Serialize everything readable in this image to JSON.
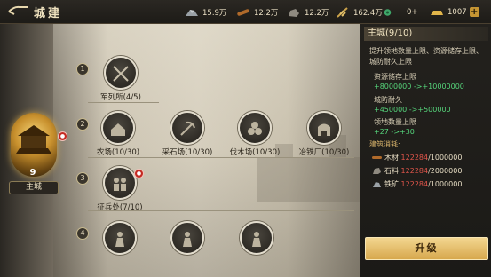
{
  "header": {
    "title": "城建"
  },
  "resources": [
    {
      "icon": "silver-ore-icon",
      "value": "15.9万"
    },
    {
      "icon": "wood-icon",
      "value": "12.2万"
    },
    {
      "icon": "stone-icon",
      "value": "12.2万"
    },
    {
      "icon": "grain-icon",
      "value": "162.4万"
    },
    {
      "icon": "jade-icon",
      "value": "0+"
    },
    {
      "icon": "gold-icon",
      "value": "1007"
    }
  ],
  "map": {
    "tiers": [
      "1",
      "2",
      "3",
      "4"
    ],
    "main_city": {
      "level": "9",
      "name": "主城"
    },
    "buildings": {
      "barracks": "军列所(4/5)",
      "farm": "农场(10/30)",
      "quarry": "采石场(10/30)",
      "lumber": "伐木场(10/30)",
      "smelter": "冶铁厂(10/30)",
      "recruit": "征兵处(7/10)"
    }
  },
  "panel": {
    "title": "主城(9/10)",
    "description": "提升领地数量上限、资源储存上限、城防耐久上限",
    "stats": [
      {
        "name": "资源储存上限",
        "value": "+8000000 ->+10000000"
      },
      {
        "name": "城防耐久",
        "value": "+450000 ->+500000"
      },
      {
        "name": "领地数量上限",
        "value": "+27 ->+30"
      }
    ],
    "cost_title": "建筑消耗:",
    "costs": [
      {
        "name": "木材",
        "have": "122284",
        "need": "/1000000"
      },
      {
        "name": "石料",
        "have": "122284",
        "need": "/2000000"
      },
      {
        "name": "铁矿",
        "have": "122284",
        "need": "/1000000"
      }
    ],
    "upgrade_label": "升级"
  },
  "colors": {
    "accent": "#d7a84d",
    "positive": "#55d37a",
    "insufficient": "#e0554a"
  }
}
